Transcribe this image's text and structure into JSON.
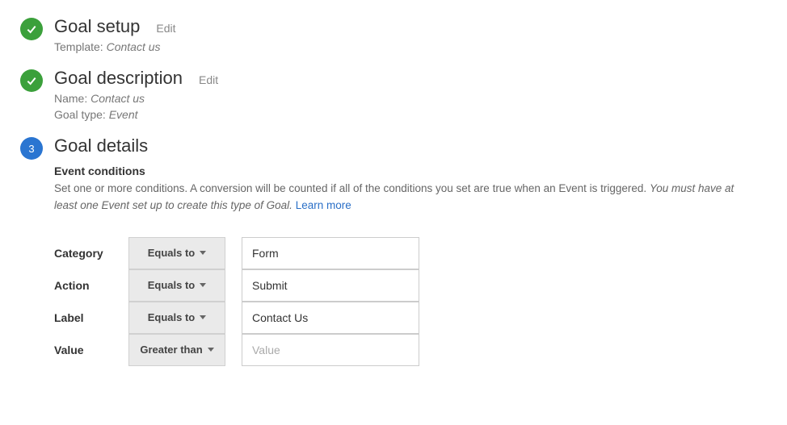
{
  "steps": {
    "setup": {
      "title": "Goal setup",
      "edit": "Edit",
      "templateLabel": "Template:",
      "templateValue": "Contact us"
    },
    "description": {
      "title": "Goal description",
      "edit": "Edit",
      "nameLabel": "Name:",
      "nameValue": "Contact us",
      "typeLabel": "Goal type:",
      "typeValue": "Event"
    },
    "details": {
      "number": "3",
      "title": "Goal details",
      "subheader": "Event conditions",
      "descPart1": "Set one or more conditions. A conversion will be counted if all of the conditions you set are true when an Event is triggered. ",
      "descItalic": "You must have at least one Event set up to create this type of Goal.",
      "learnMore": "Learn more"
    }
  },
  "conditions": [
    {
      "label": "Category",
      "operator": "Equals to",
      "value": "Form",
      "placeholder": ""
    },
    {
      "label": "Action",
      "operator": "Equals to",
      "value": "Submit",
      "placeholder": ""
    },
    {
      "label": "Label",
      "operator": "Equals to",
      "value": "Contact Us",
      "placeholder": ""
    },
    {
      "label": "Value",
      "operator": "Greater than",
      "value": "",
      "placeholder": "Value"
    }
  ]
}
